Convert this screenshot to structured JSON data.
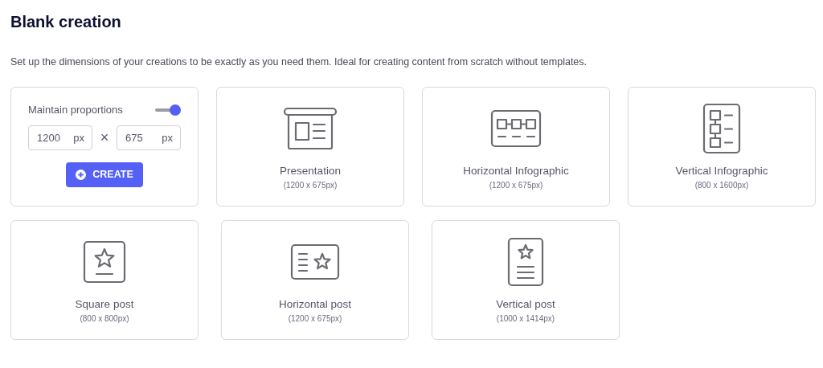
{
  "title": "Blank creation",
  "description": "Set up the dimensions of your creations to be exactly as you need them. Ideal for creating content from scratch without templates.",
  "custom": {
    "toggle_label": "Maintain proportions",
    "maintain_proportions": true,
    "width": {
      "value": "1200",
      "unit": "px"
    },
    "times": "×",
    "height": {
      "value": "675",
      "unit": "px"
    },
    "button": "CREATE"
  },
  "rows": [
    [
      {
        "kind": "presentation",
        "name": "Presentation",
        "size": "(1200 x 675px)"
      },
      {
        "kind": "horizontal-infographic",
        "name": "Horizontal Infographic",
        "size": "(1200 x 675px)"
      },
      {
        "kind": "vertical-infographic",
        "name": "Vertical Infographic",
        "size": "(800 x 1600px)"
      }
    ],
    [
      {
        "kind": "square-post",
        "name": "Square post",
        "size": "(800 x 800px)"
      },
      {
        "kind": "horizontal-post",
        "name": "Horizontal post",
        "size": "(1200 x 675px)"
      },
      {
        "kind": "vertical-post",
        "name": "Vertical post",
        "size": "(1000 x 1414px)"
      }
    ]
  ]
}
